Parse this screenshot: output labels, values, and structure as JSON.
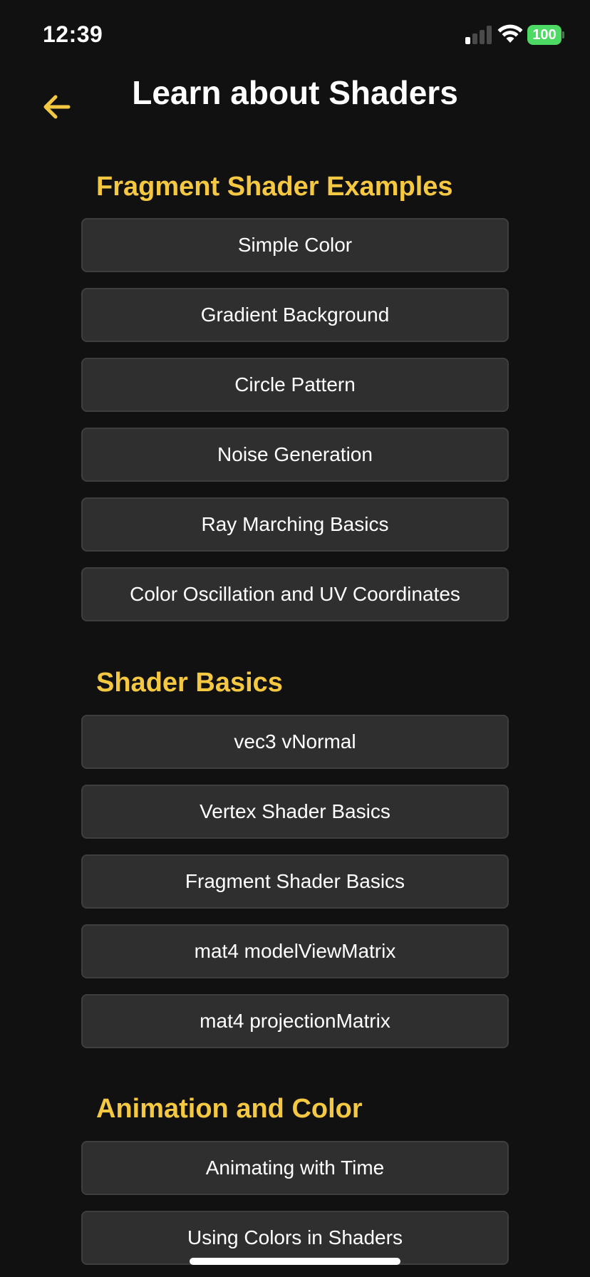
{
  "status_bar": {
    "time": "12:39",
    "battery": "100",
    "signal_icon": "cellular-signal-icon",
    "wifi_icon": "wifi-icon"
  },
  "header": {
    "title": "Learn about Shaders",
    "back_icon": "arrow-left-icon"
  },
  "colors": {
    "accent": "#f5c842",
    "background": "#111111",
    "button_bg": "#2f2f2f",
    "battery": "#4cd964"
  },
  "sections": [
    {
      "heading": "Fragment Shader Examples",
      "items": [
        "Simple Color",
        "Gradient Background",
        "Circle Pattern",
        "Noise Generation",
        "Ray Marching Basics",
        "Color Oscillation and UV Coordinates"
      ]
    },
    {
      "heading": "Shader Basics",
      "items": [
        "vec3 vNormal",
        "Vertex Shader Basics",
        "Fragment Shader Basics",
        "mat4 modelViewMatrix",
        "mat4 projectionMatrix"
      ]
    },
    {
      "heading": "Animation and Color",
      "items": [
        "Animating with Time",
        "Using Colors in Shaders"
      ]
    }
  ]
}
